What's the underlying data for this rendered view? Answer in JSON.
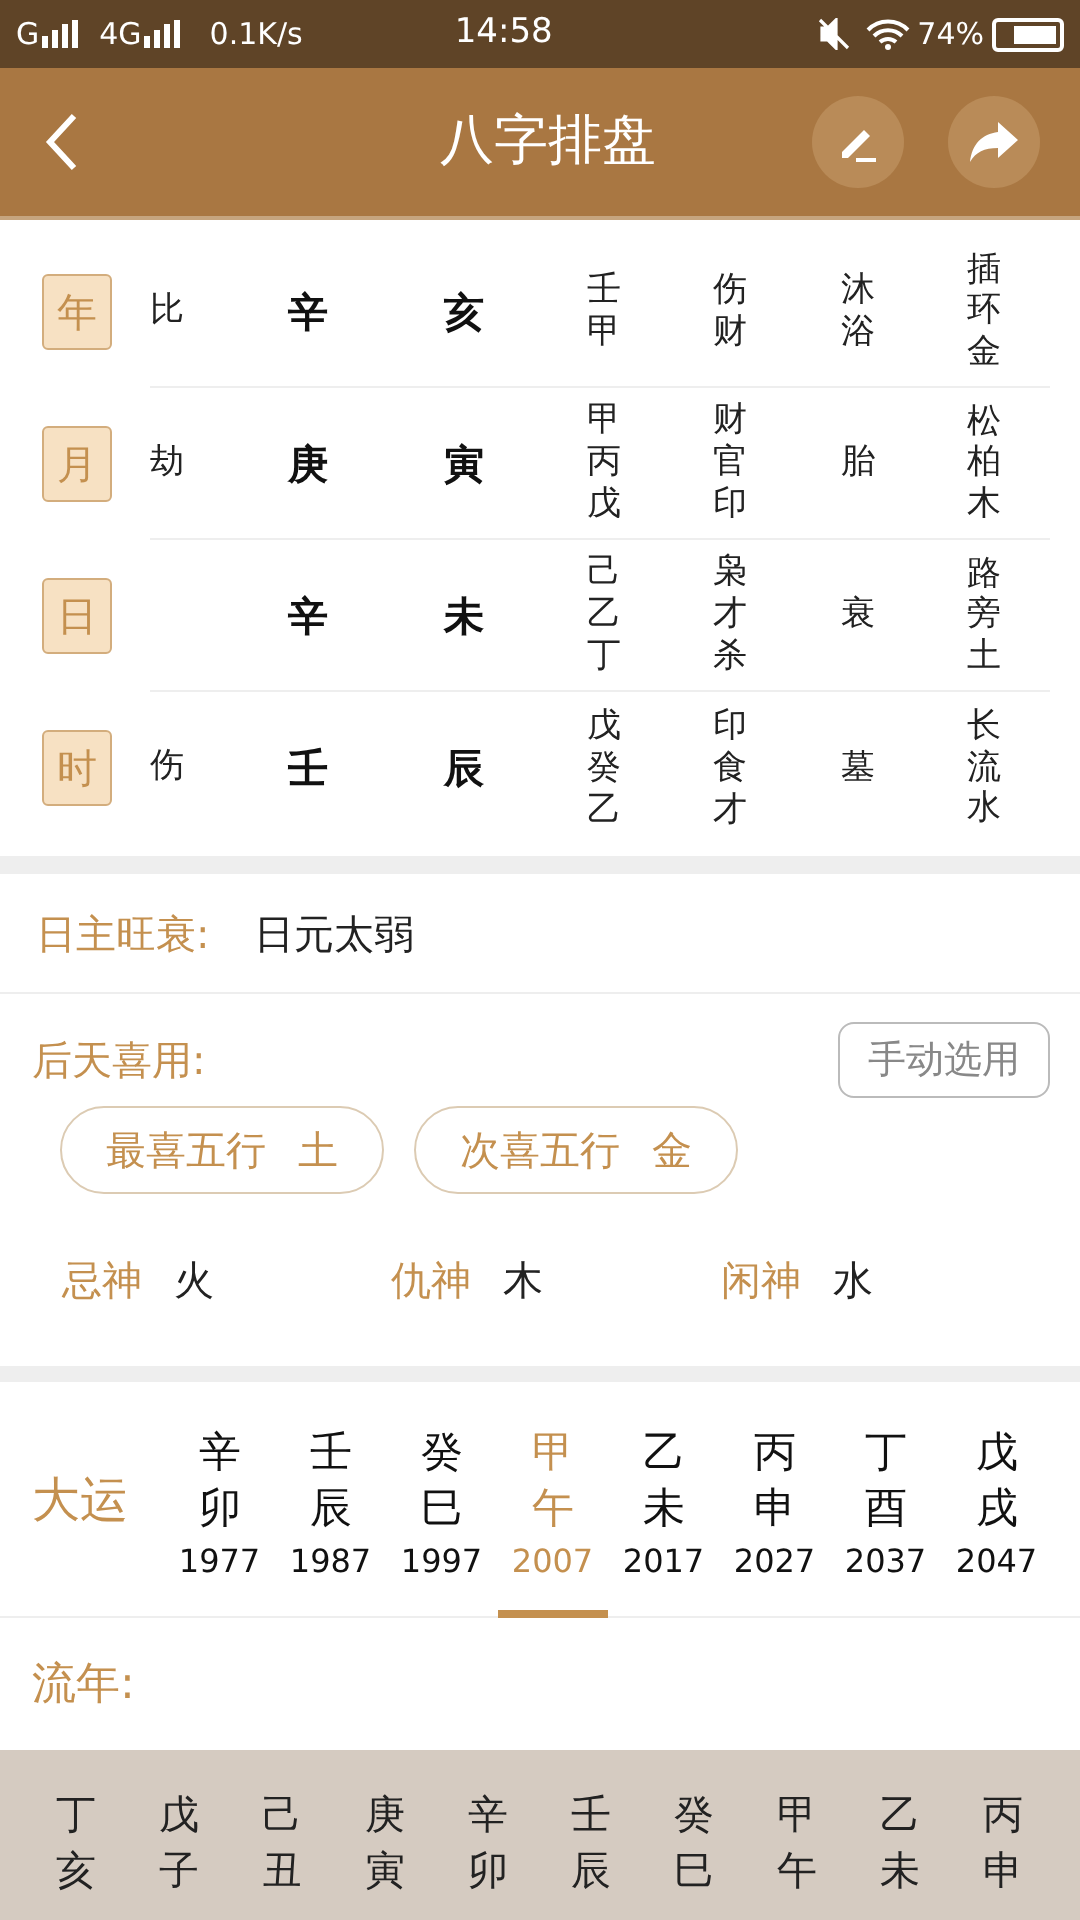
{
  "status_bar": {
    "carrier_1": "G",
    "carrier_2": "4G",
    "speed": "0.1K/s",
    "time": "14:58",
    "battery": "74%"
  },
  "header": {
    "title": "八字排盘"
  },
  "pillars": [
    {
      "label": "年",
      "ten_god": "比",
      "stem": "辛",
      "branch": "亥",
      "hidden_stems": [
        "壬",
        "甲"
      ],
      "hidden_gods": [
        "伤",
        "财"
      ],
      "life_stage": "沐浴",
      "nayin": "插环金"
    },
    {
      "label": "月",
      "ten_god": "劫",
      "stem": "庚",
      "branch": "寅",
      "hidden_stems": [
        "甲",
        "丙",
        "戊"
      ],
      "hidden_gods": [
        "财",
        "官",
        "印"
      ],
      "life_stage": "胎",
      "nayin": "松柏木"
    },
    {
      "label": "日",
      "stem": "辛",
      "branch": "未",
      "hidden_stems": [
        "己",
        "乙",
        "丁"
      ],
      "hidden_gods": [
        "枭",
        "才",
        "杀"
      ],
      "life_stage": "衰",
      "nayin": "路旁土"
    },
    {
      "label": "时",
      "ten_god": "伤",
      "stem": "壬",
      "branch": "辰",
      "hidden_stems": [
        "戊",
        "癸",
        "乙"
      ],
      "hidden_gods": [
        "印",
        "食",
        "才"
      ],
      "life_stage": "墓",
      "nayin": "长流水"
    }
  ],
  "strength": {
    "label": "日主旺衰:",
    "value": "日元太弱"
  },
  "favorable": {
    "label": "后天喜用:",
    "button": "手动选用",
    "chips": [
      {
        "label": "最喜五行",
        "value": "土"
      },
      {
        "label": "次喜五行",
        "value": "金"
      }
    ],
    "gods": [
      {
        "label": "忌神",
        "value": "火"
      },
      {
        "label": "仇神",
        "value": "木"
      },
      {
        "label": "闲神",
        "value": "水"
      }
    ]
  },
  "dayun": {
    "label": "大运",
    "items": [
      {
        "stem": "辛",
        "branch": "卯",
        "year": "1977",
        "selected": false
      },
      {
        "stem": "壬",
        "branch": "辰",
        "year": "1987",
        "selected": false
      },
      {
        "stem": "癸",
        "branch": "巳",
        "year": "1997",
        "selected": false
      },
      {
        "stem": "甲",
        "branch": "午",
        "year": "2007",
        "selected": true
      },
      {
        "stem": "乙",
        "branch": "未",
        "year": "2017",
        "selected": false
      },
      {
        "stem": "丙",
        "branch": "申",
        "year": "2027",
        "selected": false
      },
      {
        "stem": "丁",
        "branch": "酉",
        "year": "2037",
        "selected": false
      },
      {
        "stem": "戊",
        "branch": "戌",
        "year": "2047",
        "selected": false
      }
    ]
  },
  "liunian": {
    "label": "流年:",
    "items": [
      {
        "stem": "丁",
        "branch": "亥"
      },
      {
        "stem": "戊",
        "branch": "子"
      },
      {
        "stem": "己",
        "branch": "丑"
      },
      {
        "stem": "庚",
        "branch": "寅"
      },
      {
        "stem": "辛",
        "branch": "卯"
      },
      {
        "stem": "壬",
        "branch": "辰"
      },
      {
        "stem": "癸",
        "branch": "巳"
      },
      {
        "stem": "甲",
        "branch": "午"
      },
      {
        "stem": "乙",
        "branch": "未"
      },
      {
        "stem": "丙",
        "branch": "申"
      }
    ]
  }
}
